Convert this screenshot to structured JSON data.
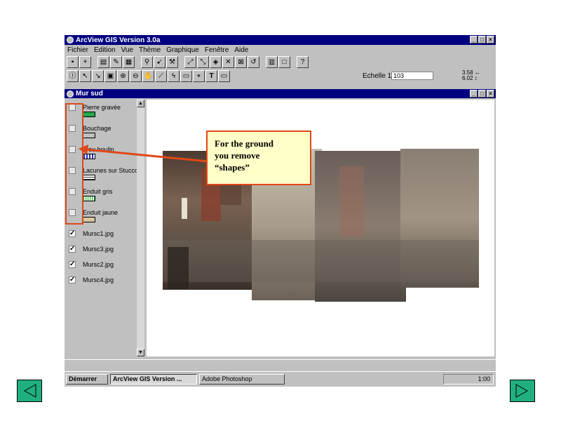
{
  "app": {
    "title": "ArcView GIS Version 3.0a",
    "menu": [
      "Fichier",
      "Edition",
      "Vue",
      "Thème",
      "Graphique",
      "Fenêtre",
      "Aide"
    ],
    "scale_label": "Echelle 1:",
    "scale_value": "103",
    "coord_x": "3.58",
    "coord_y": "6.02"
  },
  "view": {
    "title": "Mur sud",
    "layers": [
      {
        "name": "Pierre gravée",
        "checked": false,
        "symbol_color": "#1fa84a"
      },
      {
        "name": "Bouchage",
        "checked": false,
        "symbol_color": "#c0c0c0"
      },
      {
        "name": "Trou boulin",
        "checked": false,
        "symbol_color": "#2030c0"
      },
      {
        "name": "Lacunes sur Stucco",
        "checked": false,
        "symbol_color": "#303030"
      },
      {
        "name": "Enduit gris",
        "checked": false,
        "symbol_color": "#28b030"
      },
      {
        "name": "Enduit jaune",
        "checked": false,
        "symbol_color": "#d8c8a0"
      },
      {
        "name": "Mursc1.jpg",
        "checked": true
      },
      {
        "name": "Mursc3.jpg",
        "checked": true
      },
      {
        "name": "Mursc2.jpg",
        "checked": true
      },
      {
        "name": "Mursc4.jpg",
        "checked": true
      }
    ]
  },
  "taskbar": {
    "start": "Démarrer",
    "task1": "ArcView GIS Version ...",
    "task2": "Adobe Photoshop",
    "clock": "1:00"
  },
  "annotation": {
    "line1": "For the ground",
    "line2": "you remove",
    "line3": "“shapes”"
  },
  "colors": {
    "titlebar": "#000080",
    "callout_border": "#e04818",
    "nav": "#20b080"
  }
}
